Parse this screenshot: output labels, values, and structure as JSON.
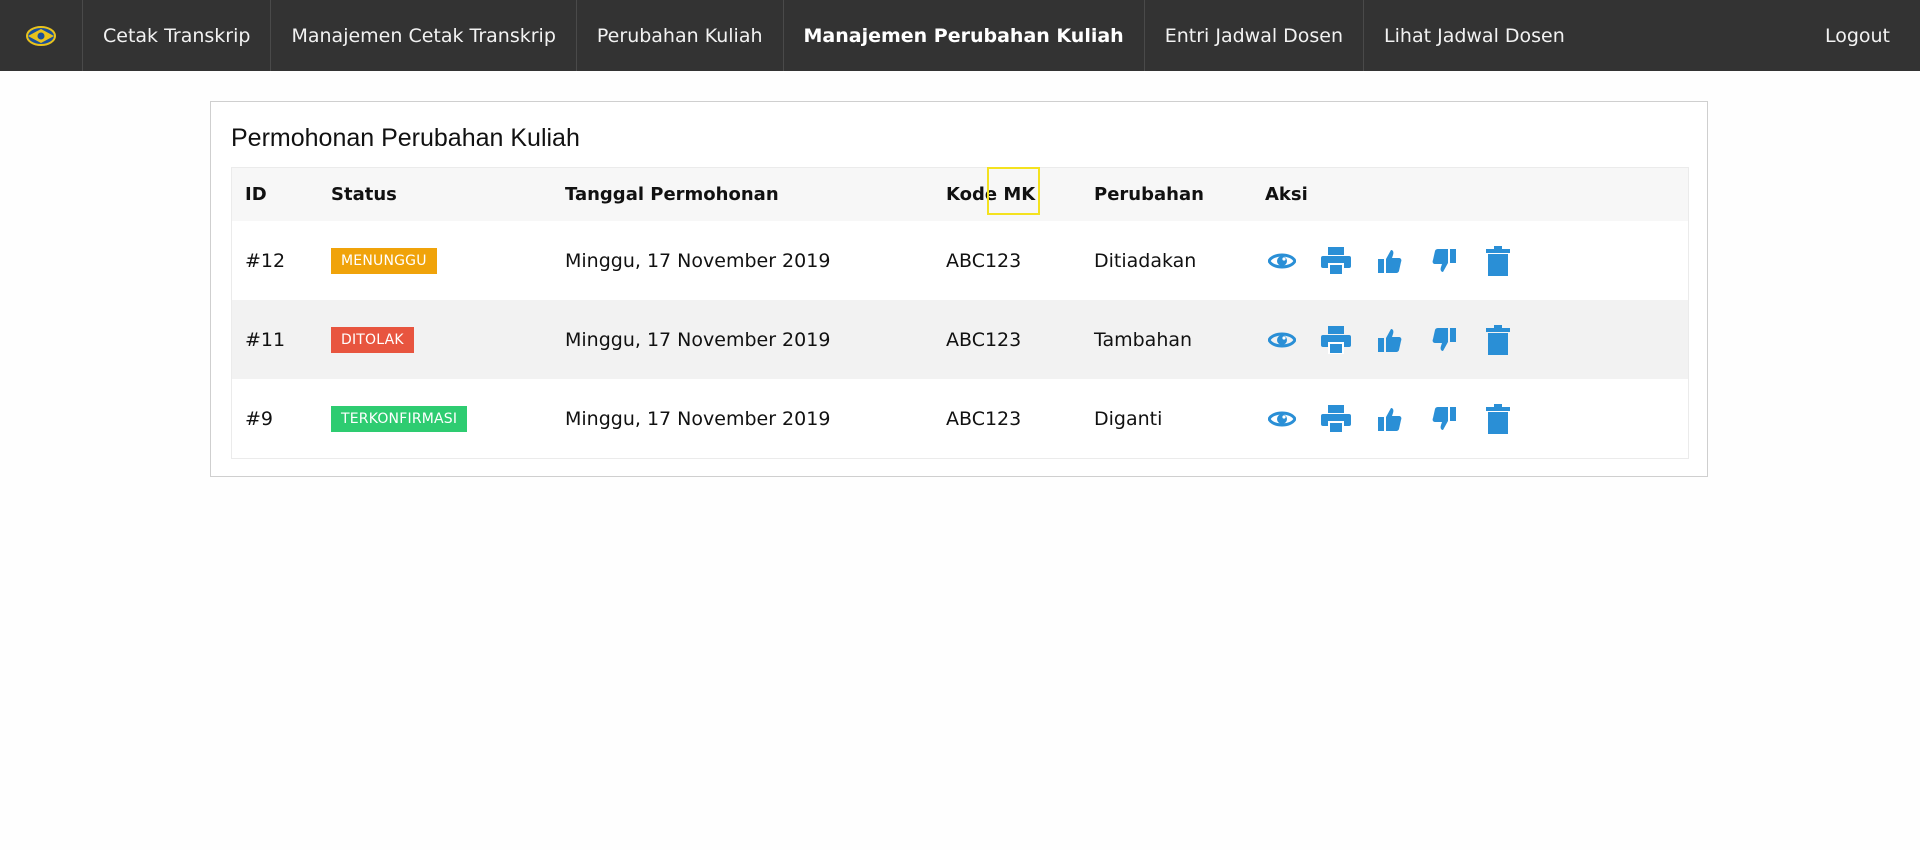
{
  "nav": {
    "logo_icon": "university-logo",
    "items": [
      {
        "label": "Cetak Transkrip"
      },
      {
        "label": "Manajemen Cetak Transkrip"
      },
      {
        "label": "Perubahan Kuliah"
      },
      {
        "label": "Manajemen Perubahan Kuliah",
        "active": true
      },
      {
        "label": "Entri Jadwal Dosen"
      },
      {
        "label": "Lihat Jadwal Dosen"
      }
    ],
    "logout": "Logout"
  },
  "card": {
    "title": "Permohonan Perubahan Kuliah"
  },
  "table": {
    "headers": {
      "id": "ID",
      "status": "Status",
      "date": "Tanggal Permohonan",
      "kode": "Kode MK",
      "perubahan": "Perubahan",
      "aksi": "Aksi"
    },
    "rows": [
      {
        "id": "#12",
        "status": "MENUNGGU",
        "status_color": "#f0a30a",
        "date": "Minggu, 17 November 2019",
        "kode": "ABC123",
        "perubahan": "Ditiadakan"
      },
      {
        "id": "#11",
        "status": "DITOLAK",
        "status_color": "#e8553f",
        "date": "Minggu, 17 November 2019",
        "kode": "ABC123",
        "perubahan": "Tambahan"
      },
      {
        "id": "#9",
        "status": "TERKONFIRMASI",
        "status_color": "#2ecc71",
        "date": "Minggu, 17 November 2019",
        "kode": "ABC123",
        "perubahan": "Diganti"
      }
    ],
    "actions": [
      "eye-icon",
      "print-icon",
      "thumbs-up-icon",
      "thumbs-down-icon",
      "trash-icon"
    ]
  },
  "colors": {
    "navbar": "#333333",
    "action_icon": "#2a8fd6",
    "highlight": "#f4e21f"
  }
}
